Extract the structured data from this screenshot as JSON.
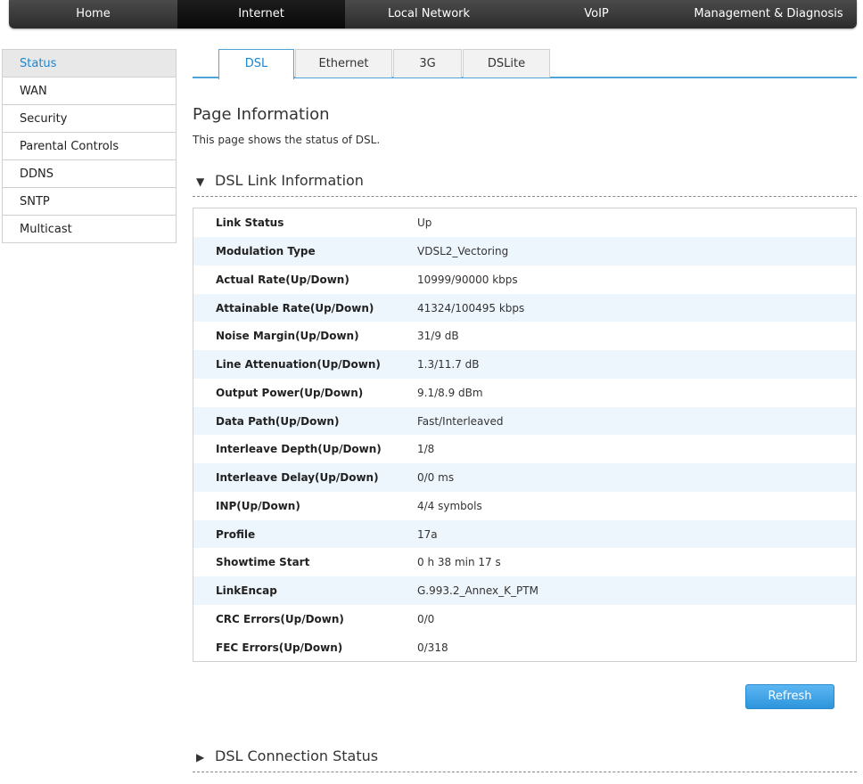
{
  "nav": {
    "items": [
      {
        "label": "Home"
      },
      {
        "label": "Internet"
      },
      {
        "label": "Local Network"
      },
      {
        "label": "VoIP"
      },
      {
        "label": "Management & Diagnosis"
      }
    ],
    "active": "Internet"
  },
  "sidebar": {
    "items": [
      {
        "label": "Status"
      },
      {
        "label": "WAN"
      },
      {
        "label": "Security"
      },
      {
        "label": "Parental Controls"
      },
      {
        "label": "DDNS"
      },
      {
        "label": "SNTP"
      },
      {
        "label": "Multicast"
      }
    ],
    "active": "Status"
  },
  "tabs": {
    "items": [
      {
        "label": "DSL"
      },
      {
        "label": "Ethernet"
      },
      {
        "label": "3G"
      },
      {
        "label": "DSLite"
      }
    ],
    "active": "DSL"
  },
  "page": {
    "title": "Page Information",
    "description": "This page shows the status of DSL."
  },
  "link_section": {
    "arrow": "▼",
    "title": "DSL Link Information",
    "rows": [
      {
        "key": "Link Status",
        "value": "Up"
      },
      {
        "key": "Modulation Type",
        "value": "VDSL2_Vectoring"
      },
      {
        "key": "Actual Rate(Up/Down)",
        "value": "10999/90000 kbps"
      },
      {
        "key": "Attainable Rate(Up/Down)",
        "value": "41324/100495 kbps"
      },
      {
        "key": "Noise Margin(Up/Down)",
        "value": "31/9 dB"
      },
      {
        "key": "Line Attenuation(Up/Down)",
        "value": "1.3/11.7 dB"
      },
      {
        "key": "Output Power(Up/Down)",
        "value": "9.1/8.9 dBm"
      },
      {
        "key": "Data Path(Up/Down)",
        "value": "Fast/Interleaved"
      },
      {
        "key": "Interleave Depth(Up/Down)",
        "value": "1/8"
      },
      {
        "key": "Interleave Delay(Up/Down)",
        "value": "0/0 ms"
      },
      {
        "key": "INP(Up/Down)",
        "value": "4/4 symbols"
      },
      {
        "key": "Profile",
        "value": "17a"
      },
      {
        "key": "Showtime Start",
        "value": "0 h 38 min 17 s"
      },
      {
        "key": "LinkEncap",
        "value": "G.993.2_Annex_K_PTM"
      },
      {
        "key": "CRC Errors(Up/Down)",
        "value": "0/0"
      },
      {
        "key": "FEC Errors(Up/Down)",
        "value": "0/318"
      }
    ]
  },
  "refresh_label": "Refresh",
  "connection_section": {
    "arrow": "▶",
    "title": "DSL Connection Status"
  },
  "colors": {
    "accent": "#1a86cf",
    "tab_border": "#4ea3d8",
    "row_alt": "#eef6fd",
    "nav_bg": "#3a3a3a",
    "button": "#2d95dc"
  },
  "icons": {
    "expand_arrow": "triangle-down-icon",
    "collapse_arrow": "triangle-right-icon"
  }
}
